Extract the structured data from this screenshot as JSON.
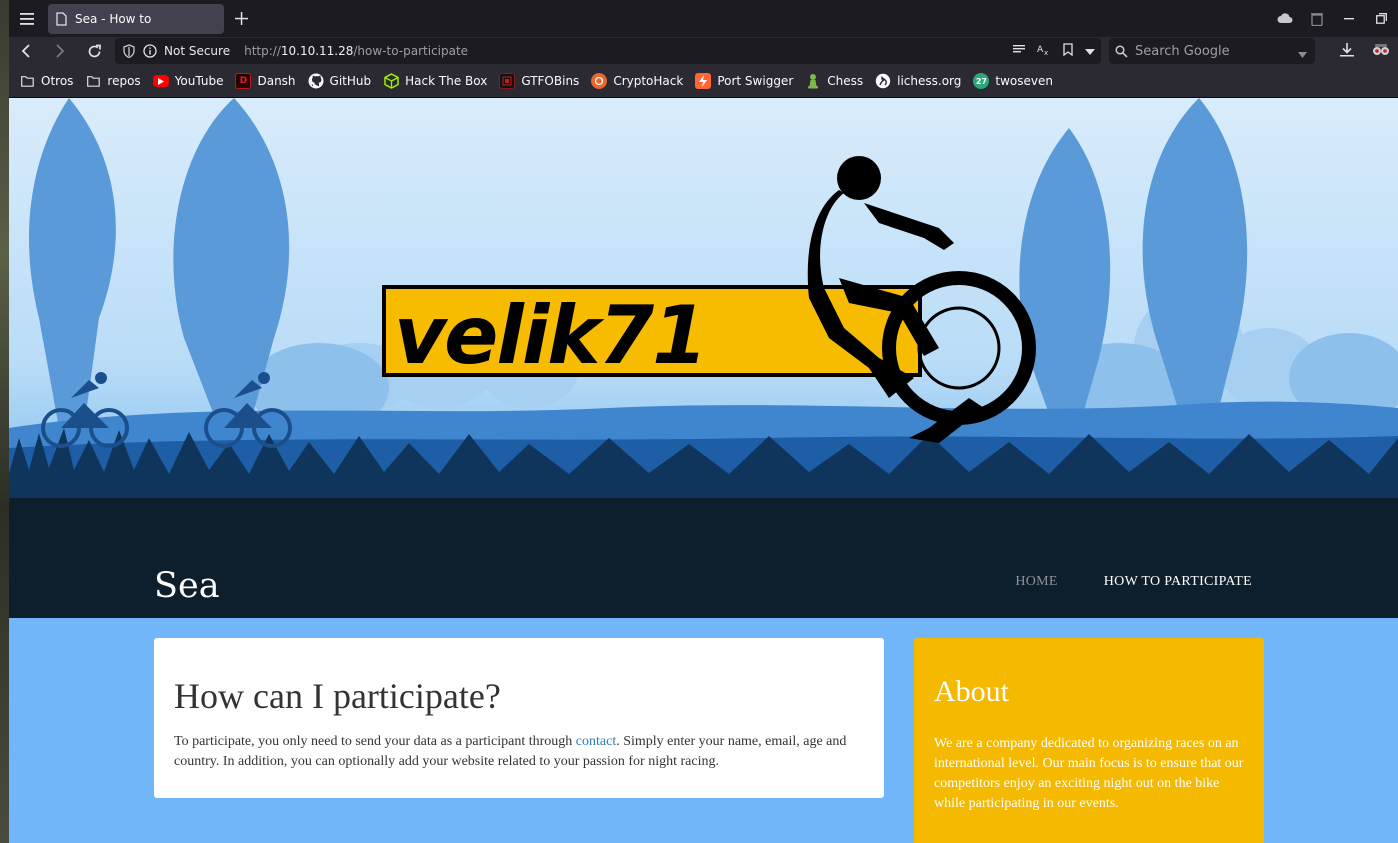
{
  "browser": {
    "tab_title": "Sea - How to",
    "url": {
      "prefix": "http://",
      "host": "10.10.11.28",
      "path": "/how-to-participate"
    },
    "security_label": "Not Secure",
    "search_placeholder": "Search Google"
  },
  "bookmarks": [
    {
      "label": "Otros",
      "icon": "folder-icon"
    },
    {
      "label": "repos",
      "icon": "folder-icon"
    },
    {
      "label": "YouTube",
      "icon": "youtube-icon",
      "color": "#ff0000"
    },
    {
      "label": "Dansh",
      "icon": "dansh-icon",
      "color": "#c01818"
    },
    {
      "label": "GitHub",
      "icon": "github-icon"
    },
    {
      "label": "Hack The Box",
      "icon": "hackthebox-icon",
      "color": "#9fef00"
    },
    {
      "label": "GTFOBins",
      "icon": "gtfobins-icon",
      "color": "#8b1a1a"
    },
    {
      "label": "CryptoHack",
      "icon": "cryptohack-icon",
      "color": "#e8672a"
    },
    {
      "label": "Port Swigger",
      "icon": "portswigger-icon",
      "color": "#ff6633"
    },
    {
      "label": "Chess",
      "icon": "chess-pawn-icon",
      "color": "#81b64c"
    },
    {
      "label": "lichess.org",
      "icon": "lichess-icon"
    },
    {
      "label": "twoseven",
      "icon": "twoseven-icon",
      "color": "#2aa876"
    }
  ],
  "site": {
    "title": "Sea",
    "logo_text": "velik71",
    "nav": {
      "home": "HOME",
      "how": "HOW TO PARTICIPATE"
    }
  },
  "main": {
    "heading": "How can I participate?",
    "text_before": "To participate, you only need to send your data as a participant through ",
    "link": "contact",
    "text_after": ". Simply enter your name, email, age and country. In addition, you can optionally add your website related to your passion for night racing."
  },
  "about": {
    "heading": "About",
    "text": "We are a company dedicated to organizing races on an international level. Our main focus is to ensure that our competitors enjoy an exciting night out on the bike while participating in our events."
  },
  "colors": {
    "about_bg": "#f5b900",
    "content_bg": "#70b6f8",
    "link": "#337ab7",
    "logo_yellow": "#f7bb00"
  }
}
